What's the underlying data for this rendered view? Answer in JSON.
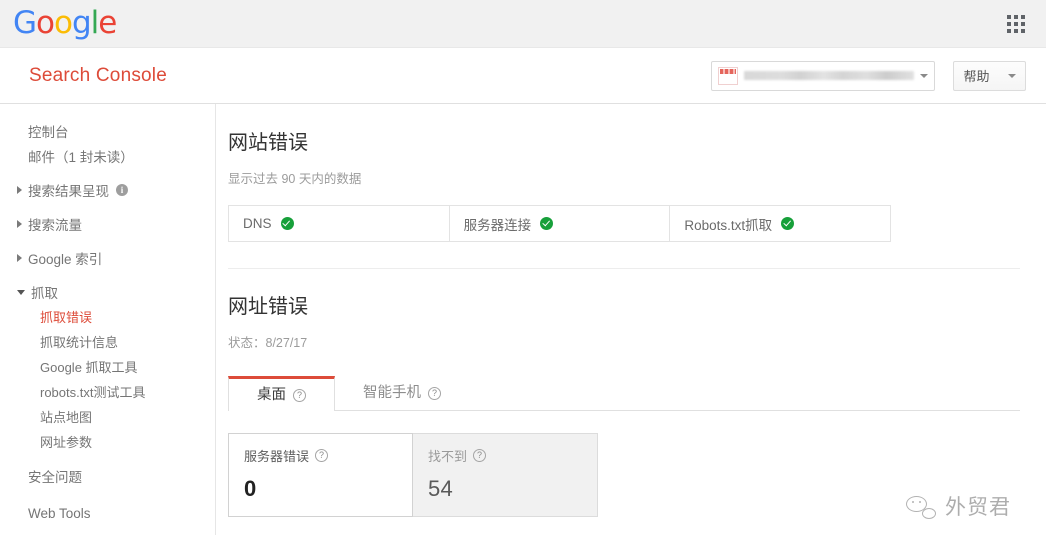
{
  "google_bar": {
    "logo_letters": [
      {
        "ch": "G",
        "color": "#4285F4"
      },
      {
        "ch": "o",
        "color": "#EA4335"
      },
      {
        "ch": "o",
        "color": "#FBBC05"
      },
      {
        "ch": "g",
        "color": "#4285F4"
      },
      {
        "ch": "l",
        "color": "#34A853"
      },
      {
        "ch": "e",
        "color": "#EA4335"
      }
    ],
    "apps_icon": "apps-grid-icon"
  },
  "appbar": {
    "title": "Search Console",
    "site_selector": {
      "value": "",
      "redacted": true,
      "caret_icon": "chevron-down-icon"
    },
    "help_button": {
      "label": "帮助",
      "caret_icon": "chevron-down-icon"
    }
  },
  "sidebar": {
    "items": [
      {
        "label": "控制台",
        "type": "link",
        "active": false
      },
      {
        "label": "邮件（1 封未读）",
        "type": "link",
        "active": false
      },
      {
        "label": "搜索结果呈现",
        "type": "group",
        "expanded": false,
        "info_icon": "info-icon"
      },
      {
        "label": "搜索流量",
        "type": "group",
        "expanded": false
      },
      {
        "label": "Google 索引",
        "type": "group",
        "expanded": false
      },
      {
        "label": "抓取",
        "type": "group",
        "expanded": true
      },
      {
        "label": "抓取错误",
        "type": "sub",
        "active": true
      },
      {
        "label": "抓取统计信息",
        "type": "sub",
        "active": false
      },
      {
        "label": "Google 抓取工具",
        "type": "sub",
        "active": false
      },
      {
        "label": "robots.txt测试工具",
        "type": "sub",
        "active": false
      },
      {
        "label": "站点地图",
        "type": "sub",
        "active": false
      },
      {
        "label": "网址参数",
        "type": "sub",
        "active": false
      },
      {
        "label": "安全问题",
        "type": "link",
        "active": false
      },
      {
        "label": "Web Tools",
        "type": "link",
        "active": false
      }
    ]
  },
  "main": {
    "site_errors": {
      "title": "网站错误",
      "subtitle": "显示过去 90 天内的数据",
      "cells": [
        {
          "label": "DNS",
          "status": "ok",
          "status_icon": "check-circle-icon"
        },
        {
          "label": "服务器连接",
          "status": "ok",
          "status_icon": "check-circle-icon"
        },
        {
          "label": "Robots.txt抓取",
          "status": "ok",
          "status_icon": "check-circle-icon"
        }
      ]
    },
    "url_errors": {
      "title": "网址错误",
      "status_line": "状态：8/27/17",
      "tabs": [
        {
          "label": "桌面",
          "active": true,
          "help_icon": "question-circle-icon"
        },
        {
          "label": "智能手机",
          "active": false,
          "help_icon": "question-circle-icon"
        }
      ],
      "cards": [
        {
          "label": "服务器错误",
          "value": "0",
          "selected": true,
          "help_icon": "question-circle-icon"
        },
        {
          "label": "找不到",
          "value": "54",
          "selected": false,
          "help_icon": "question-circle-icon"
        }
      ]
    }
  },
  "watermark": {
    "text": "外贸君",
    "icon": "wechat-icon"
  },
  "colors": {
    "brand_red": "#dd4b39",
    "ok_green": "#17a03a",
    "google_blue": "#4285F4",
    "google_yellow": "#FBBC05",
    "google_green": "#34A853"
  }
}
